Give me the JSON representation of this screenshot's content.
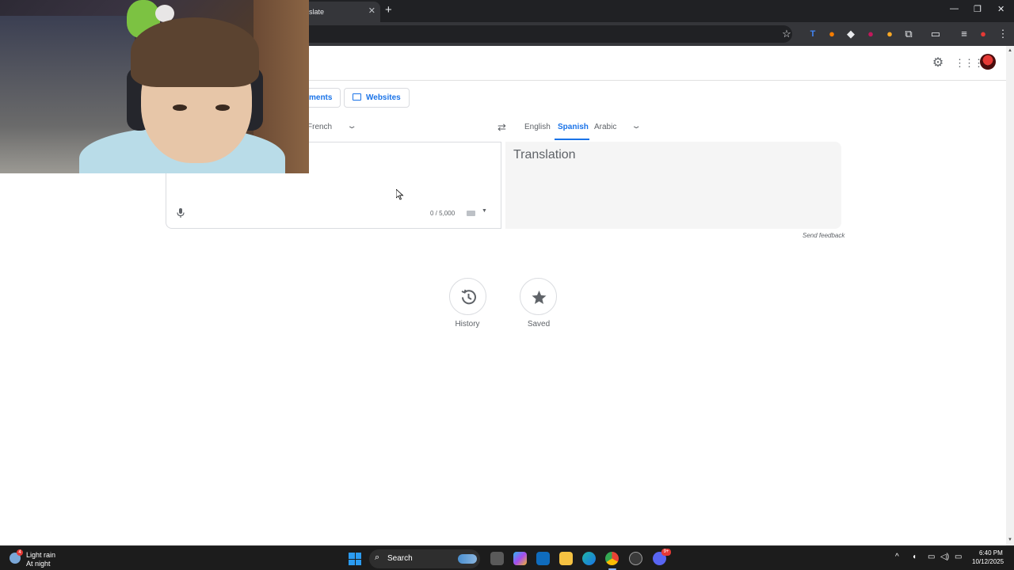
{
  "browser": {
    "tab_title": "slate",
    "tab_close": "✕",
    "new_tab": "+",
    "window_controls": [
      "—",
      "❐",
      "✕"
    ]
  },
  "translate": {
    "modes": [
      {
        "label": "ments"
      },
      {
        "label": "Websites"
      }
    ],
    "source_lang_selected": "French",
    "target_langs": [
      "English",
      "Spanish",
      "Arabic"
    ],
    "target_selected": "Spanish",
    "char_count": "0 / 5,000",
    "translation_placeholder": "Translation",
    "send_feedback": "Send feedback",
    "history_label": "History",
    "saved_label": "Saved"
  },
  "taskbar": {
    "weather_badge": "4",
    "weather_line1": "Light rain",
    "weather_line2": "At night",
    "search_label": "Search",
    "discord_badge": "9+",
    "time": "6:40 PM",
    "date": "10/12/2025"
  },
  "colors": {
    "accent": "#1a73e8",
    "titlebar": "#202124",
    "toolbar": "#35363a",
    "taskbar": "#1c1c1c"
  }
}
